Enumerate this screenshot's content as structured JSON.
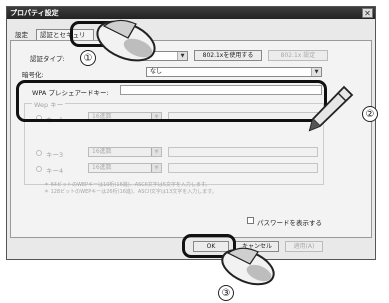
{
  "window": {
    "title": "プロパティ設定"
  },
  "tabs": [
    {
      "label": "設定"
    },
    {
      "label": "認証とセキュリティ"
    }
  ],
  "auth": {
    "type_label": "認証タイプ:",
    "use_8021x_button": "802.1xを使用する",
    "settings_8021x_button": "802.1x 設定"
  },
  "encryption": {
    "label": "暗号化:",
    "value": "なし"
  },
  "wpa": {
    "label": "WPA プレシェアードキー:"
  },
  "wep": {
    "group_label": "Wep キー",
    "keys": [
      {
        "label": "キー1",
        "format": "16進数"
      },
      {
        "label": "キー3",
        "format": "16進数"
      },
      {
        "label": "キー4",
        "format": "16進数"
      }
    ],
    "note_line1": "＊ 64ビットのWEPキーは10桁(16進)、ASCII文字は5文字を入力します。",
    "note_line2": "＊ 128ビットのWEPキーは26桁(16進)、ASCII文字は13文字を入力します。"
  },
  "show_password_label": "パスワードを表示する",
  "buttons": {
    "ok": "OK",
    "cancel": "キャンセル",
    "apply": "適用(A)"
  },
  "callouts": [
    "①",
    "②",
    "③"
  ]
}
